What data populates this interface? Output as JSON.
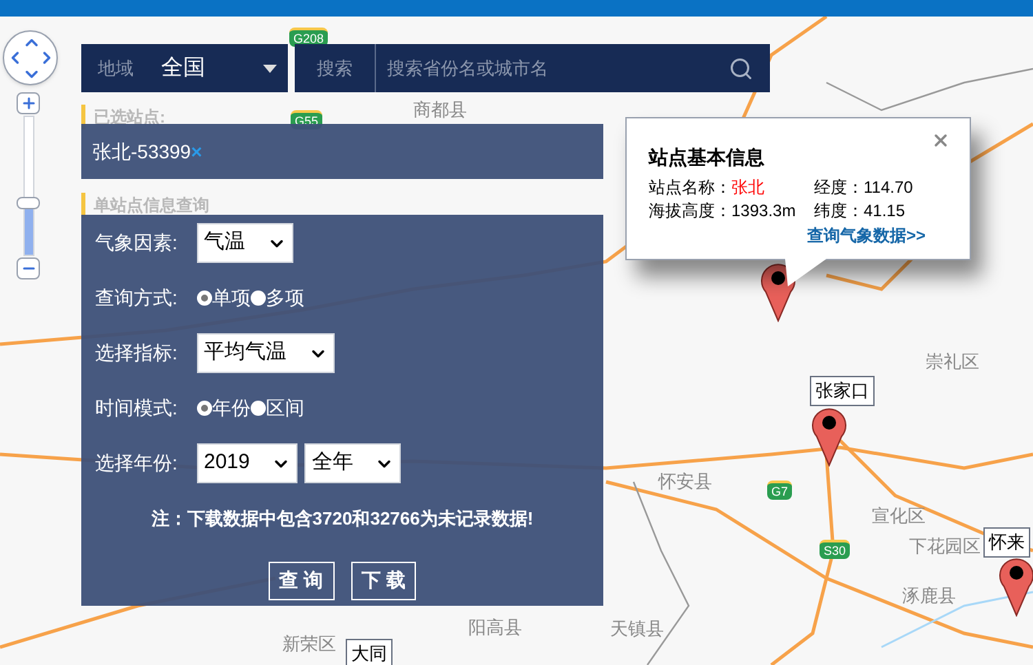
{
  "map": {
    "labels": [
      {
        "text": "商都县"
      },
      {
        "text": "崇礼区"
      },
      {
        "text": "怀安县"
      },
      {
        "text": "宣化区"
      },
      {
        "text": "下花园区"
      },
      {
        "text": "涿鹿县"
      },
      {
        "text": "天镇县"
      },
      {
        "text": "阳高县"
      },
      {
        "text": "新荣区"
      }
    ],
    "city_tags": [
      {
        "text": "张家口"
      },
      {
        "text": "怀来"
      },
      {
        "text": "大同"
      }
    ],
    "road_shields": [
      {
        "text": "G208"
      },
      {
        "text": "G55"
      },
      {
        "text": "G7"
      },
      {
        "text": "S30"
      }
    ],
    "zoom": {
      "level": 0.37
    }
  },
  "search_bar": {
    "region_label": "地域",
    "region_value": "全国",
    "search_label": "搜索",
    "placeholder": "搜索省份名或城市名"
  },
  "selected_stations": {
    "heading": "已选站点:",
    "items": [
      {
        "name": "张北-53399",
        "remove": "×"
      }
    ]
  },
  "query": {
    "heading": "单站点信息查询",
    "fields": [
      {
        "kind": "select",
        "label": "气象因素:",
        "values": [
          "气温"
        ]
      },
      {
        "kind": "radio",
        "label": "查询方式:",
        "options": [
          {
            "label": "单项",
            "selected": true
          },
          {
            "label": "多项",
            "selected": false
          }
        ]
      },
      {
        "kind": "select",
        "label": "选择指标:",
        "values": [
          "平均气温"
        ]
      },
      {
        "kind": "radio",
        "label": "时间模式:",
        "options": [
          {
            "label": "年份",
            "selected": true
          },
          {
            "label": "区间",
            "selected": false
          }
        ]
      },
      {
        "kind": "select",
        "label": "选择年份:",
        "values": [
          "2019",
          "全年"
        ]
      }
    ],
    "note": "注：下载数据中包含3720和32766为未记录数据!",
    "buttons": [
      "查 询",
      "下 载"
    ]
  },
  "popup": {
    "title": "站点基本信息",
    "rows": [
      [
        {
          "label": "站点名称：",
          "value": "张北",
          "highlight": true
        },
        {
          "label": "经度：",
          "value": "114.70",
          "highlight": false
        }
      ],
      [
        {
          "label": "海拔高度：",
          "value": "1393.3m",
          "highlight": false
        },
        {
          "label": "纬度：",
          "value": "41.15",
          "highlight": false
        }
      ]
    ],
    "link": "查询气象数据>>"
  }
}
